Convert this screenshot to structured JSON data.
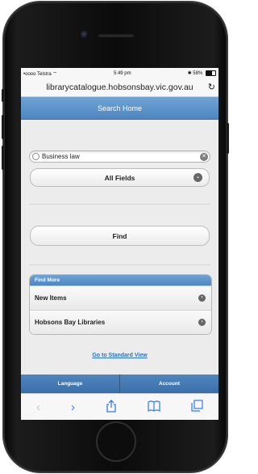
{
  "status": {
    "carrier": "•oooo Telstra",
    "time": "5:49 pm",
    "battery": "58%"
  },
  "browser": {
    "url": "librarycatalogue.hobsonsbay.vic.gov.au",
    "reload_icon": "↻"
  },
  "header": {
    "title": "Search Home"
  },
  "search": {
    "value": "Business law",
    "clear_icon": "✕"
  },
  "field_select": {
    "selected": "All Fields",
    "chevron_icon": "⌄"
  },
  "find_button": {
    "label": "Find"
  },
  "find_more": {
    "heading": "Find More",
    "items": [
      {
        "label": "New Items"
      },
      {
        "label": "Hobsons Bay Libraries"
      }
    ]
  },
  "standard_view_link": "Go to Standard View",
  "tabs": [
    {
      "label": "Language"
    },
    {
      "label": "Account"
    }
  ],
  "toolbar_icons": {
    "back": "‹",
    "forward": "›",
    "share": "⇪",
    "bookmarks": "📖",
    "tabs": "⧉"
  }
}
